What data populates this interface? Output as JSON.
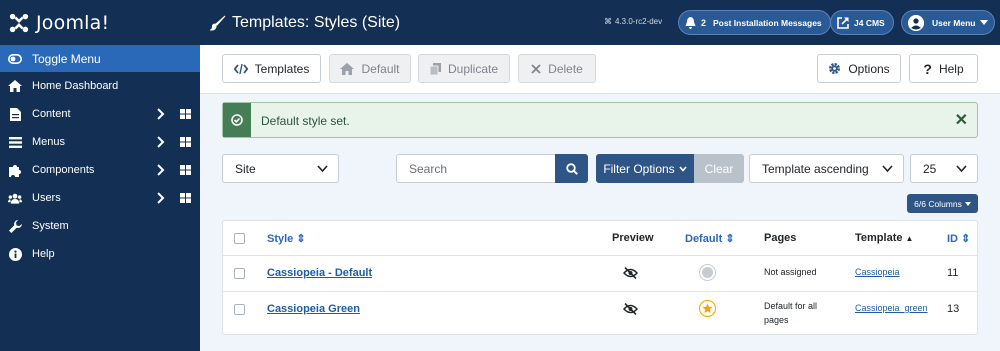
{
  "brand": {
    "name": "Joomla!"
  },
  "sidebar": {
    "items": [
      {
        "label": "Toggle Menu",
        "icon": "toggle-icon"
      },
      {
        "label": "Home Dashboard",
        "icon": "home-icon"
      },
      {
        "label": "Content",
        "icon": "file-icon",
        "has_submenu": true,
        "has_dashboard": true
      },
      {
        "label": "Menus",
        "icon": "list-icon",
        "has_submenu": true,
        "has_dashboard": true
      },
      {
        "label": "Components",
        "icon": "puzzle-icon",
        "has_submenu": true,
        "has_dashboard": true
      },
      {
        "label": "Users",
        "icon": "users-icon",
        "has_submenu": true,
        "has_dashboard": true
      },
      {
        "label": "System",
        "icon": "wrench-icon"
      },
      {
        "label": "Help",
        "icon": "info-icon"
      }
    ]
  },
  "header": {
    "title": "Templates: Styles (Site)",
    "version": "4.3.0-rc2-dev",
    "post_install": {
      "count": "2",
      "label": "Post Installation Messages"
    },
    "site_link": "J4 CMS",
    "user_menu": "User Menu"
  },
  "toolbar": {
    "templates": "Templates",
    "default": "Default",
    "duplicate": "Duplicate",
    "delete": "Delete",
    "options": "Options",
    "help": "Help"
  },
  "alert": {
    "message": "Default style set.",
    "close": "✕"
  },
  "filters": {
    "client": "Site",
    "search_placeholder": "Search",
    "filter_options": "Filter Options",
    "clear": "Clear",
    "ordering": "Template ascending",
    "limit": "25",
    "columns": "6/6 Columns"
  },
  "table": {
    "headers": {
      "style": "Style",
      "preview": "Preview",
      "default": "Default",
      "pages": "Pages",
      "template": "Template",
      "id": "ID"
    },
    "rows": [
      {
        "style": "Cassiopeia - Default",
        "is_default": false,
        "pages": "Not assigned",
        "template": "Cassiopeia",
        "id": "11"
      },
      {
        "style": "Cassiopeia Green",
        "is_default": true,
        "pages_line1": "Default for all",
        "pages_line2": "pages",
        "template": "Cassiopeia_green",
        "id": "13"
      }
    ]
  },
  "colors": {
    "sidebar_bg": "#132f53",
    "accent": "#2a69b8",
    "success": "#457d54",
    "star": "#f0a500"
  }
}
